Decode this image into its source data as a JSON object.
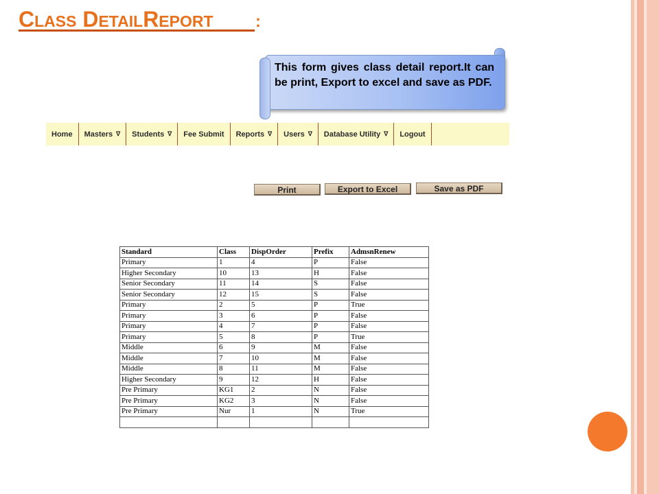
{
  "slide": {
    "title_first": "C",
    "title_rest": "lass",
    "title_word2_first": "D",
    "title_word2_rest": "etail",
    "title_word3_first": "R",
    "title_word3_rest": "eport",
    "colon": ":"
  },
  "callout": {
    "text": "This form gives class detail report.It can be print, Export to excel and save as PDF."
  },
  "menu": {
    "items": [
      {
        "label": "Home",
        "has_dropdown": false
      },
      {
        "label": "Masters",
        "has_dropdown": true
      },
      {
        "label": "Students",
        "has_dropdown": true
      },
      {
        "label": "Fee Submit",
        "has_dropdown": false
      },
      {
        "label": "Reports",
        "has_dropdown": true
      },
      {
        "label": "Users",
        "has_dropdown": true
      },
      {
        "label": "Database Utility",
        "has_dropdown": true
      },
      {
        "label": "Logout",
        "has_dropdown": false
      }
    ],
    "dropdown_glyph": "∇"
  },
  "buttons": {
    "print": "Print",
    "export_excel": "Export to Excel",
    "save_pdf": "Save as PDF"
  },
  "table": {
    "headers": [
      "Standard",
      "Class",
      "DispOrder",
      "Prefix",
      "AdmsnRenew"
    ],
    "rows": [
      [
        "Primary",
        "1",
        "4",
        "P",
        "False"
      ],
      [
        "Higher Secondary",
        "10",
        "13",
        "H",
        "False"
      ],
      [
        "Senior Secondary",
        "11",
        "14",
        "S",
        "False"
      ],
      [
        "Senior Secondary",
        "12",
        "15",
        "S",
        "False"
      ],
      [
        "Primary",
        "2",
        "5",
        "P",
        "True"
      ],
      [
        "Primary",
        "3",
        "6",
        "P",
        "False"
      ],
      [
        "Primary",
        "4",
        "7",
        "P",
        "False"
      ],
      [
        "Primary",
        "5",
        "8",
        "P",
        "True"
      ],
      [
        "Middle",
        "6",
        "9",
        "M",
        "False"
      ],
      [
        "Middle",
        "7",
        "10",
        "M",
        "False"
      ],
      [
        "Middle",
        "8",
        "11",
        "M",
        "False"
      ],
      [
        "Higher Secondary",
        "9",
        "12",
        "H",
        "False"
      ],
      [
        "Pre Primary",
        "KG1",
        "2",
        "N",
        "False"
      ],
      [
        "Pre Primary",
        "KG2",
        "3",
        "N",
        "False"
      ],
      [
        "Pre Primary",
        "Nur",
        "1",
        "N",
        "True"
      ],
      [
        "",
        "",
        "",
        "",
        ""
      ]
    ]
  },
  "colors": {
    "title": "#e8711e",
    "menu_bg": "#fcf9c9",
    "menu_divider": "#a0522d",
    "callout_blue": "#7ea1ec",
    "circle": "#f5792c"
  }
}
